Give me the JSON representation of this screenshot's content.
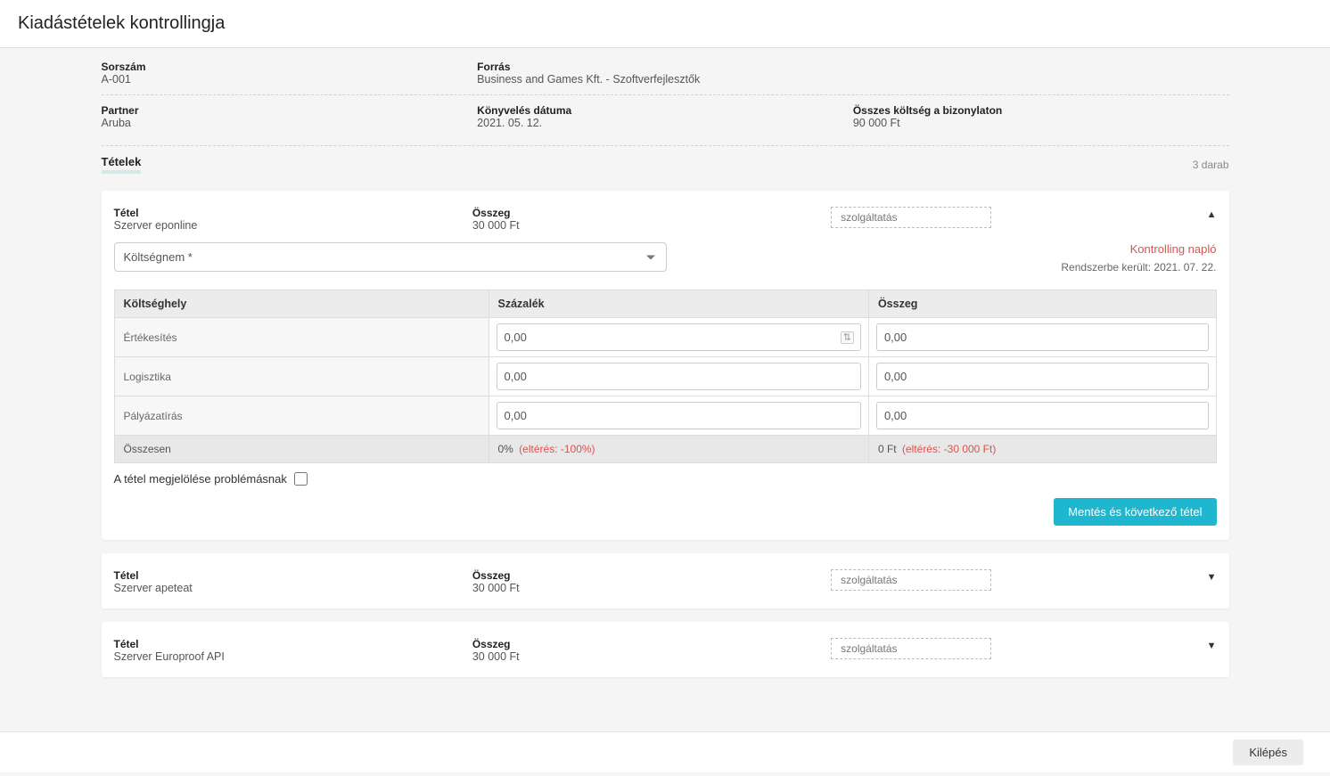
{
  "page_title": "Kiadástételek kontrollingja",
  "meta": {
    "serial_label": "Sorszám",
    "serial_value": "A-001",
    "source_label": "Forrás",
    "source_value": "Business and Games Kft. - Szoftverfejlesztők",
    "partner_label": "Partner",
    "partner_value": "Aruba",
    "booking_date_label": "Könyvelés dátuma",
    "booking_date_value": "2021. 05. 12.",
    "total_cost_label": "Összes költség a bizonylaton",
    "total_cost_value": "90 000 Ft"
  },
  "items_section": {
    "title": "Tételek",
    "count": "3 darab"
  },
  "item_labels": {
    "name": "Tétel",
    "amount": "Összeg"
  },
  "expanded_item": {
    "name": "Szerver eponline",
    "amount": "30 000 Ft",
    "tag": "szolgáltatás",
    "cost_type_placeholder": "Költségnem *",
    "log_link": "Kontrolling napló",
    "system_date_label": "Rendszerbe került: 2021. 07. 22.",
    "table": {
      "headers": {
        "place": "Költséghely",
        "percent": "Százalék",
        "amount": "Összeg"
      },
      "rows": [
        {
          "place": "Értékesítés",
          "percent": "0,00",
          "amount": "0,00",
          "show_icon": true
        },
        {
          "place": "Logisztika",
          "percent": "0,00",
          "amount": "0,00",
          "show_icon": false
        },
        {
          "place": "Pályázatírás",
          "percent": "0,00",
          "amount": "0,00",
          "show_icon": false
        }
      ],
      "totals": {
        "label": "Összesen",
        "percent_text": "0% ",
        "percent_deviation": "(eltérés: -100%)",
        "amount_text": "0 Ft ",
        "amount_deviation": "(eltérés: -30 000 Ft)"
      }
    },
    "problem_label": "A tétel megjelölése problémásnak",
    "save_button": "Mentés és következő tétel"
  },
  "collapsed_items": [
    {
      "name": "Szerver apeteat",
      "amount": "30 000 Ft",
      "tag": "szolgáltatás"
    },
    {
      "name": "Szerver Europroof API",
      "amount": "30 000 Ft",
      "tag": "szolgáltatás"
    }
  ],
  "footer": {
    "exit": "Kilépés"
  }
}
